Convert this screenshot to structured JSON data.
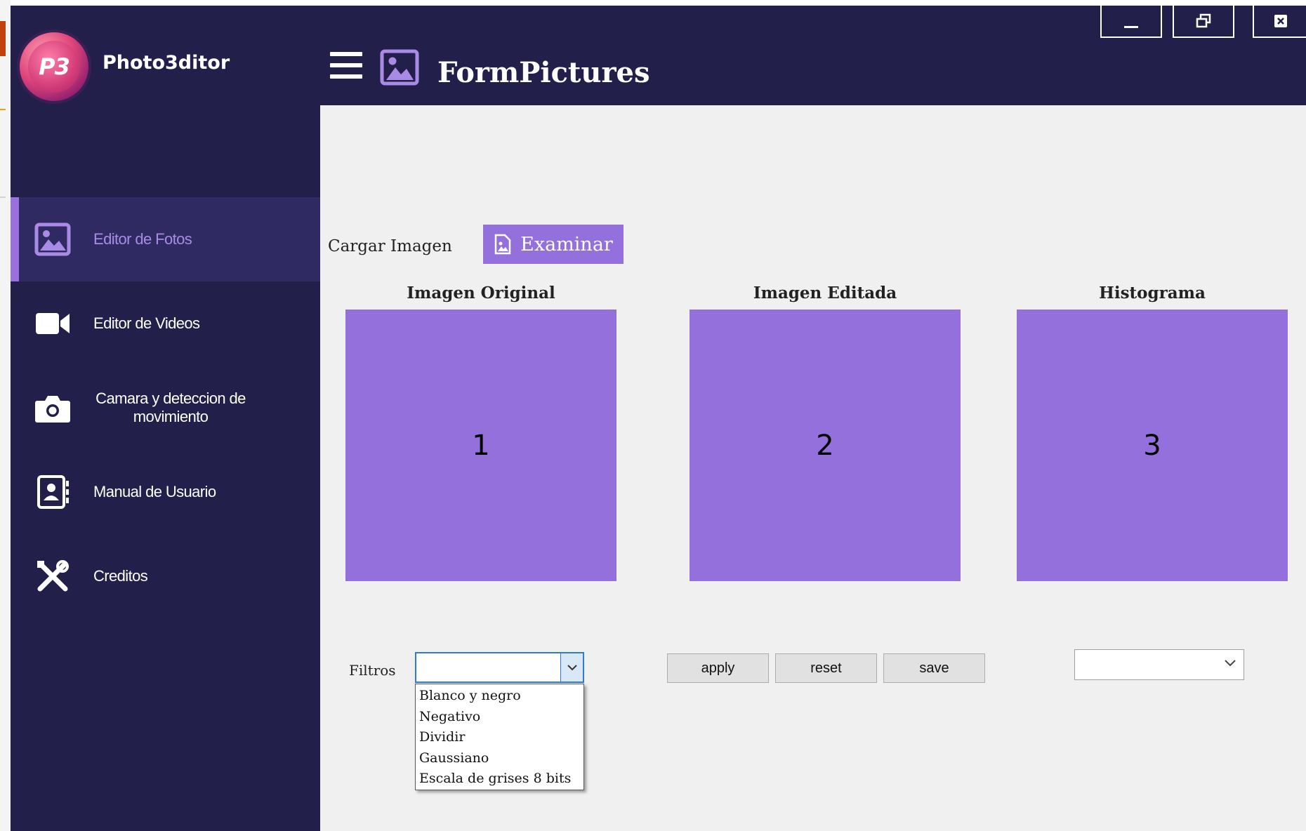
{
  "app": {
    "logo_text": "P3",
    "name": "Photo3ditor"
  },
  "header": {
    "title": "FormPictures"
  },
  "window_controls": [
    "minimize",
    "restore",
    "close"
  ],
  "sidebar": {
    "items": [
      {
        "label": "Editor de Fotos",
        "icon": "image-icon",
        "active": true
      },
      {
        "label": "Editor de Videos",
        "icon": "video-camera-icon",
        "active": false
      },
      {
        "label": "Camara y deteccion de movimiento",
        "icon": "camera-icon",
        "active": false
      },
      {
        "label": "Manual de Usuario",
        "icon": "contact-book-icon",
        "active": false
      },
      {
        "label": "Creditos",
        "icon": "tools-icon",
        "active": false
      }
    ]
  },
  "load": {
    "label": "Cargar Imagen",
    "button_label": "Examinar"
  },
  "panels": [
    {
      "title": "Imagen Original",
      "number": "1"
    },
    {
      "title": "Imagen Editada",
      "number": "2"
    },
    {
      "title": "Histograma",
      "number": "3"
    }
  ],
  "filters": {
    "label": "Filtros",
    "selected": "",
    "options": [
      "Blanco y negro",
      "Negativo",
      "Dividir",
      "Gaussiano",
      "Escala de grises 8 bits"
    ]
  },
  "actions": {
    "apply": "apply",
    "reset": "reset",
    "save": "save"
  },
  "histogram_select": {
    "selected": ""
  },
  "colors": {
    "sidebar_bg": "#22204a",
    "active_item_bg": "#2f2b62",
    "accent": "#9370db",
    "content_bg": "#f0f0f0"
  }
}
